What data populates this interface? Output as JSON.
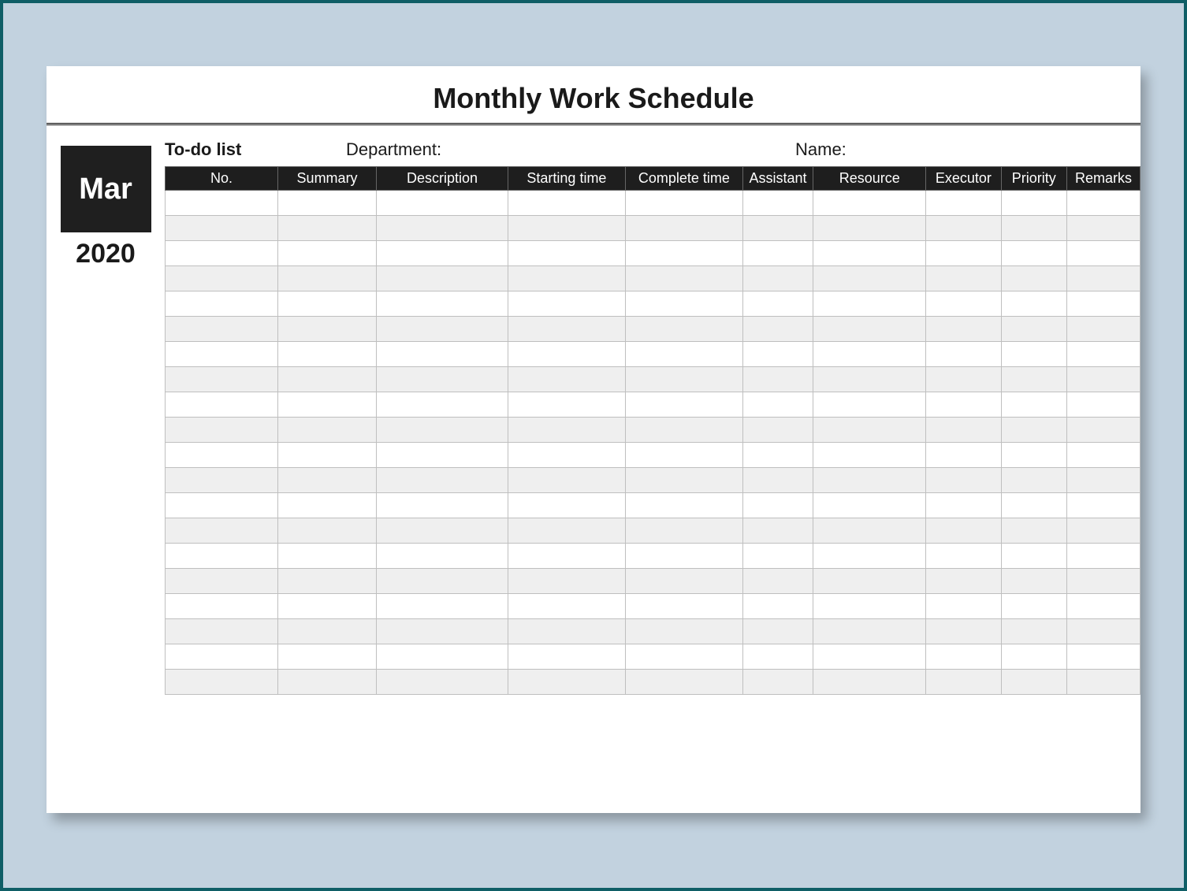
{
  "title": "Monthly Work Schedule",
  "side": {
    "month": "Mar",
    "year": "2020"
  },
  "labels": {
    "todo": "To-do list",
    "department": "Department:",
    "name": "Name:"
  },
  "columns": [
    "No.",
    "Summary",
    "Description",
    "Starting time",
    "Complete time",
    "Assistant",
    "Resource",
    "Executor",
    "Priority",
    "Remarks"
  ],
  "rows": [
    [
      "",
      "",
      "",
      "",
      "",
      "",
      "",
      "",
      "",
      ""
    ],
    [
      "",
      "",
      "",
      "",
      "",
      "",
      "",
      "",
      "",
      ""
    ],
    [
      "",
      "",
      "",
      "",
      "",
      "",
      "",
      "",
      "",
      ""
    ],
    [
      "",
      "",
      "",
      "",
      "",
      "",
      "",
      "",
      "",
      ""
    ],
    [
      "",
      "",
      "",
      "",
      "",
      "",
      "",
      "",
      "",
      ""
    ],
    [
      "",
      "",
      "",
      "",
      "",
      "",
      "",
      "",
      "",
      ""
    ],
    [
      "",
      "",
      "",
      "",
      "",
      "",
      "",
      "",
      "",
      ""
    ],
    [
      "",
      "",
      "",
      "",
      "",
      "",
      "",
      "",
      "",
      ""
    ],
    [
      "",
      "",
      "",
      "",
      "",
      "",
      "",
      "",
      "",
      ""
    ],
    [
      "",
      "",
      "",
      "",
      "",
      "",
      "",
      "",
      "",
      ""
    ],
    [
      "",
      "",
      "",
      "",
      "",
      "",
      "",
      "",
      "",
      ""
    ],
    [
      "",
      "",
      "",
      "",
      "",
      "",
      "",
      "",
      "",
      ""
    ],
    [
      "",
      "",
      "",
      "",
      "",
      "",
      "",
      "",
      "",
      ""
    ],
    [
      "",
      "",
      "",
      "",
      "",
      "",
      "",
      "",
      "",
      ""
    ],
    [
      "",
      "",
      "",
      "",
      "",
      "",
      "",
      "",
      "",
      ""
    ],
    [
      "",
      "",
      "",
      "",
      "",
      "",
      "",
      "",
      "",
      ""
    ],
    [
      "",
      "",
      "",
      "",
      "",
      "",
      "",
      "",
      "",
      ""
    ],
    [
      "",
      "",
      "",
      "",
      "",
      "",
      "",
      "",
      "",
      ""
    ],
    [
      "",
      "",
      "",
      "",
      "",
      "",
      "",
      "",
      "",
      ""
    ],
    [
      "",
      "",
      "",
      "",
      "",
      "",
      "",
      "",
      "",
      ""
    ]
  ]
}
